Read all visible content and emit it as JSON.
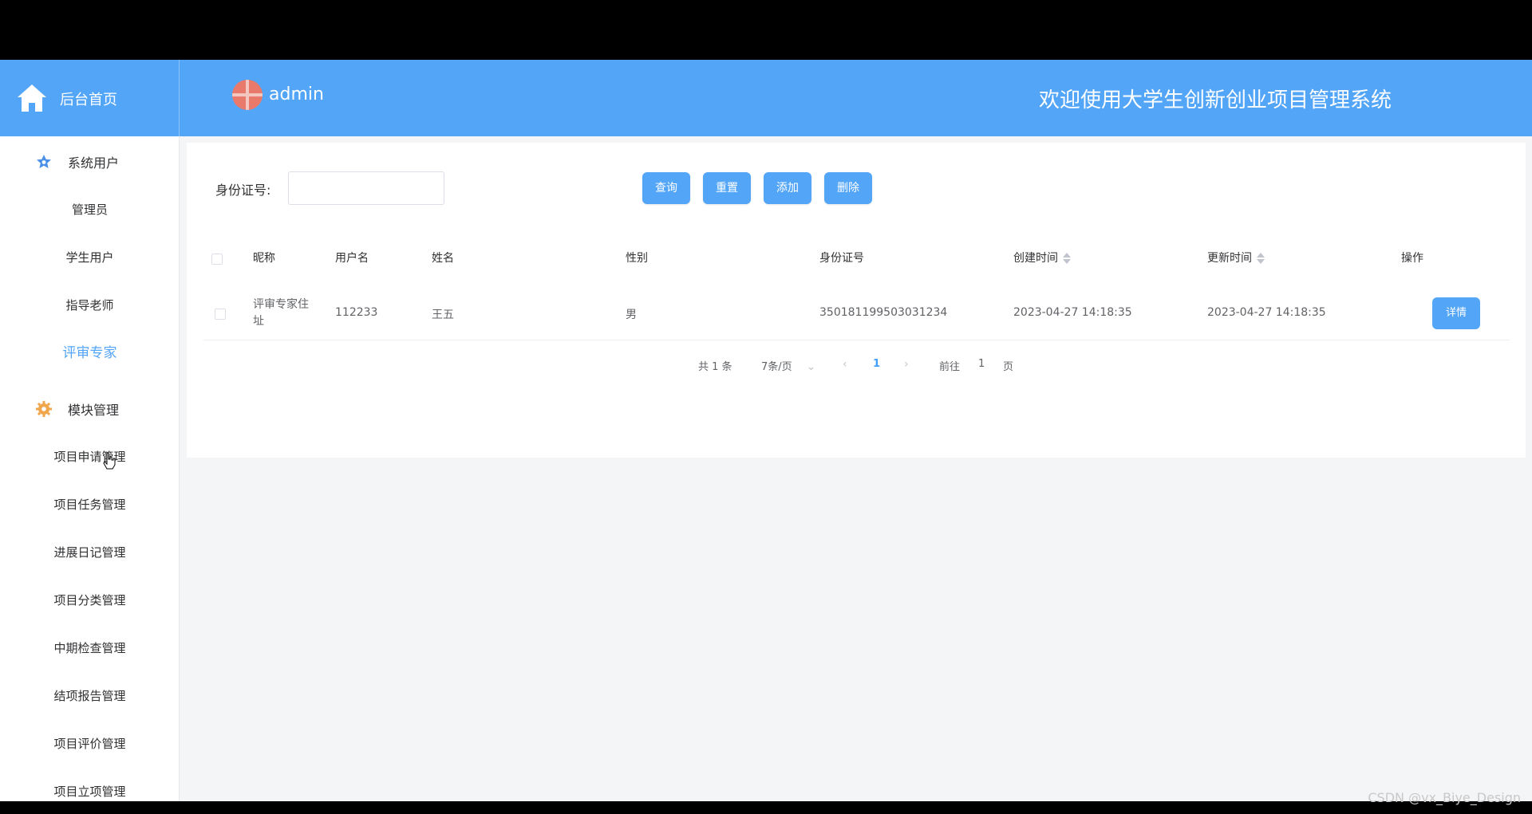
{
  "header": {
    "home_label": "后台首页",
    "admin_name": "admin",
    "system_title": "欢迎使用大学生创新创业项目管理系统"
  },
  "sidebar": {
    "groups": [
      {
        "label": "系统用户",
        "icon": "star-icon"
      },
      {
        "label": "模块管理",
        "icon": "gear-icon"
      }
    ],
    "items_user": [
      "管理员",
      "学生用户",
      "指导老师",
      "评审专家"
    ],
    "items_module": [
      "项目申请管理",
      "项目任务管理",
      "进展日记管理",
      "项目分类管理",
      "中期检查管理",
      "结项报告管理",
      "项目评价管理",
      "项目立项管理"
    ],
    "active_item": "评审专家"
  },
  "search": {
    "label": "身份证号:",
    "value": "",
    "buttons": {
      "query": "查询",
      "reset": "重置",
      "add": "添加",
      "delete": "删除"
    }
  },
  "table": {
    "headers": [
      "昵称",
      "用户名",
      "姓名",
      "性别",
      "身份证号",
      "创建时间",
      "更新时间",
      "操作"
    ],
    "rows": [
      {
        "nickname": "评审专家住址",
        "nickname_line1": "评审专家住",
        "nickname_line2": "址",
        "username": "112233",
        "name": "王五",
        "gender": "男",
        "id_number": "350181199503031234",
        "created": "2023-04-27 14:18:35",
        "updated": "2023-04-27 14:18:35",
        "action": "详情"
      }
    ]
  },
  "pagination": {
    "total": "共 1 条",
    "page_size": "7条/页",
    "current": "1",
    "goto_label": "前往",
    "goto_value": "1",
    "page_suffix": "页"
  },
  "watermark": "CSDN @vx_Biye_Design",
  "colors": {
    "primary": "#53a5f8",
    "link": "#409eff"
  }
}
